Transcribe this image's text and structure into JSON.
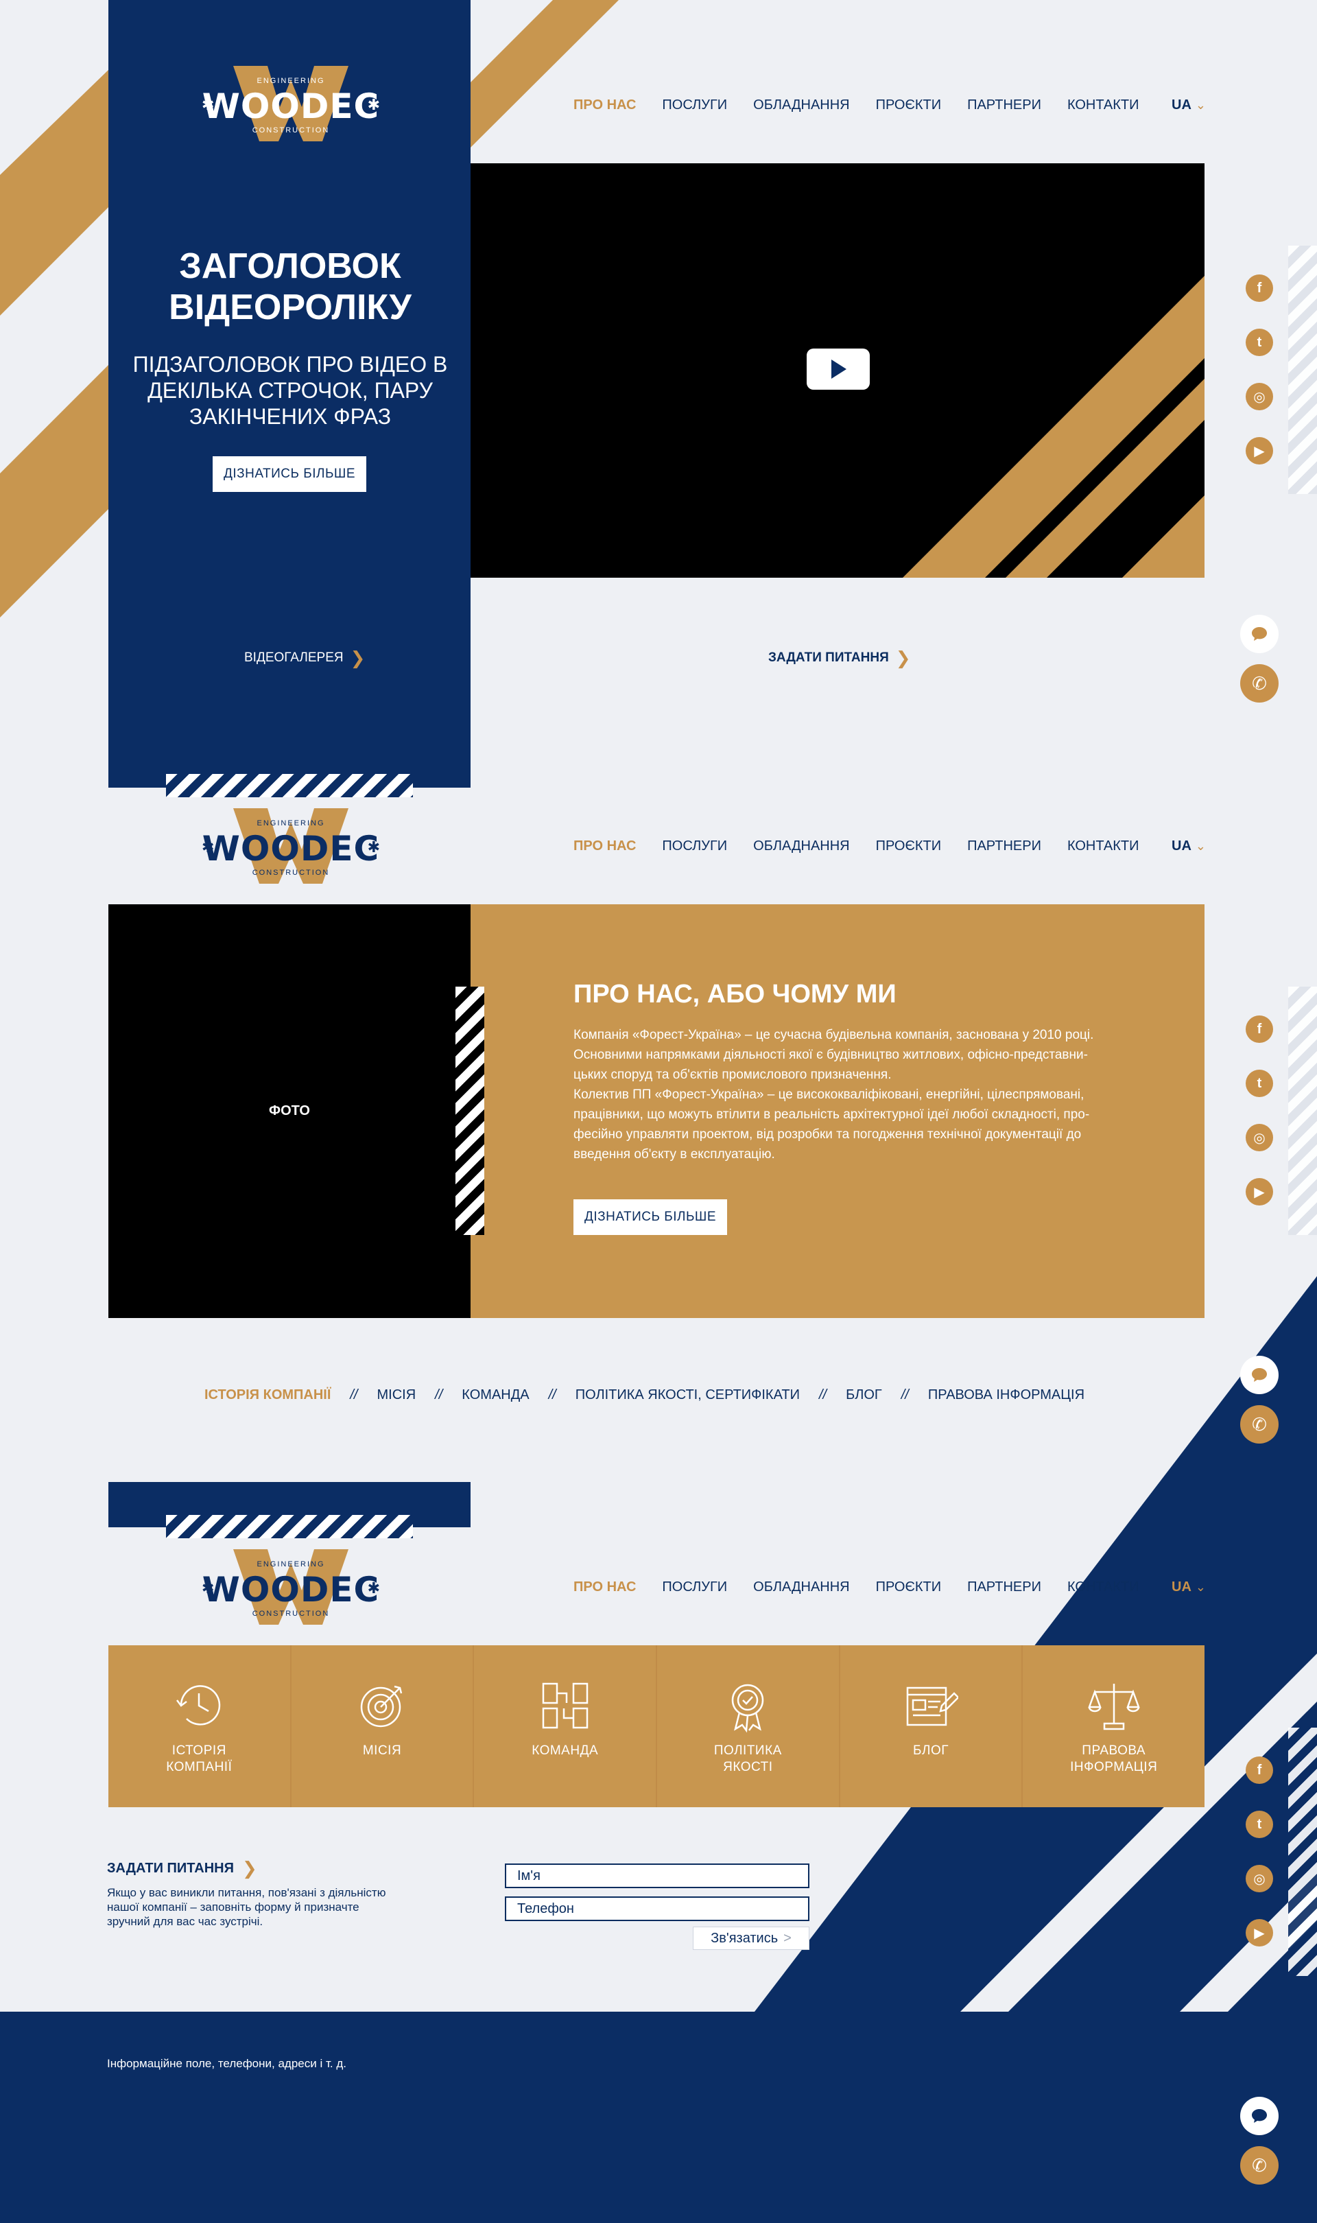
{
  "brand": {
    "logo_word": "WOODEC",
    "logo_top": "ENGINEERING",
    "logo_bottom": "CONSTRUCTION"
  },
  "nav": {
    "items": [
      "ПРО НАС",
      "ПОСЛУГИ",
      "ОБЛАДНАННЯ",
      "ПРОЄКТИ",
      "ПАРТНЕРИ",
      "КОНТАКТИ"
    ],
    "active_index": 0,
    "lang": "UA"
  },
  "hero": {
    "title": "ЗАГОЛОВОК ВІДЕОРОЛІКУ",
    "subtitle": "ПІДЗАГОЛОВОК ПРО ВІДЕО В ДЕКІЛЬКА СТРОЧОК, ПАРУ ЗАКІНЧЕНИХ ФРАЗ",
    "button": "ДІЗНАТИСЬ БІЛЬШЕ",
    "gallery_link": "ВІДЕОГАЛЕРЕЯ",
    "ask_link": "ЗАДАТИ ПИТАННЯ"
  },
  "about": {
    "photo_label": "ФОТО",
    "title": "ПРО НАС, АБО ЧОМУ МИ",
    "text": "Компанія «Форест-Україна» – це сучасна будівельна компанія, заснована у 2010 році.\nОсновними напрямками діяльності якої є будівництво житлових, офісно-представни-\nцьких споруд та об'єктів промислового призначення.\nКолектив ПП «Форест-Україна» – це висококваліфіковані, енергійні, цілеспрямовані,\nпрацівники, що можуть втілити в реальність архітектурної ідеї любої складності, про-\nфесійно управляти проектом, від розробки та погодження технічної документації до\nвведення об'єкту в експлуатацію.",
    "button": "ДІЗНАТИСЬ БІЛЬШЕ"
  },
  "subnav": {
    "items": [
      "ІСТОРІЯ КОМПАНІЇ",
      "МІСІЯ",
      "КОМАНДА",
      "ПОЛІТИКА ЯКОСТІ, СЕРТИФІКАТИ",
      "БЛОГ",
      "ПРАВОВА ІНФОРМАЦІЯ"
    ],
    "separator": "//"
  },
  "features": [
    {
      "icon": "clock-history-icon",
      "label": "ІСТОРІЯ\nКОМПАНІЇ"
    },
    {
      "icon": "target-icon",
      "label": "МІСІЯ"
    },
    {
      "icon": "team-hands-icon",
      "label": "КОМАНДА"
    },
    {
      "icon": "award-badge-icon",
      "label": "ПОЛІТИКА\nЯКОСТІ"
    },
    {
      "icon": "blog-edit-icon",
      "label": "БЛОГ"
    },
    {
      "icon": "scales-icon",
      "label": "ПРАВОВА\nІНФОРМАЦІЯ"
    }
  ],
  "contact": {
    "title": "ЗАДАТИ ПИТАННЯ",
    "text": "Якщо у вас виникли питання, пов'язані з діяльністю\nнашої компанії – заповніть форму й призначте\nзручний для вас час зустрічі.",
    "name_placeholder": "Ім'я",
    "phone_placeholder": "Телефон",
    "submit": "Зв'язатись"
  },
  "footer": {
    "text": "Інформаційне поле, телефони, адреси і т. д."
  },
  "social": [
    "facebook-icon",
    "twitter-icon",
    "instagram-icon",
    "youtube-icon"
  ],
  "colors": {
    "navy": "#0b2d64",
    "gold": "#c8964f",
    "background": "#eef0f4"
  }
}
